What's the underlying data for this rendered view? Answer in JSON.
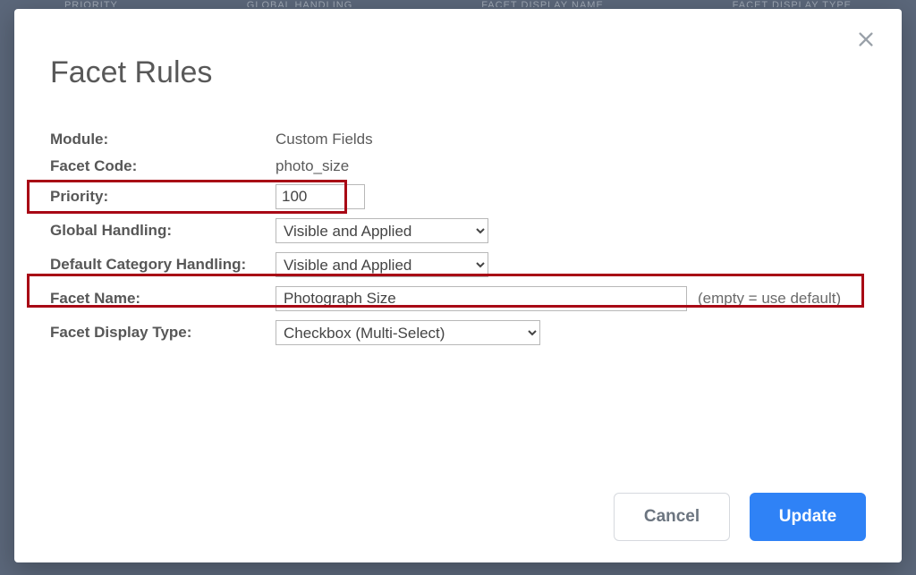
{
  "bg_columns": [
    "PRIORITY",
    "GLOBAL HANDLING",
    "FACET DISPLAY NAME",
    "FACET DISPLAY TYPE"
  ],
  "modal": {
    "title": "Facet Rules",
    "close_label": "Close",
    "fields": {
      "module": {
        "label": "Module:",
        "value": "Custom Fields"
      },
      "facet_code": {
        "label": "Facet Code:",
        "value": "photo_size"
      },
      "priority": {
        "label": "Priority:",
        "value": "100"
      },
      "global_handling": {
        "label": "Global Handling:",
        "value": "Visible and Applied"
      },
      "default_category_handling": {
        "label": "Default Category Handling:",
        "value": "Visible and Applied"
      },
      "facet_name": {
        "label": "Facet Name:",
        "value": "Photograph Size",
        "hint": "(empty = use default)"
      },
      "facet_display_type": {
        "label": "Facet Display Type:",
        "value": "Checkbox (Multi-Select)"
      }
    },
    "buttons": {
      "cancel": "Cancel",
      "update": "Update"
    }
  }
}
